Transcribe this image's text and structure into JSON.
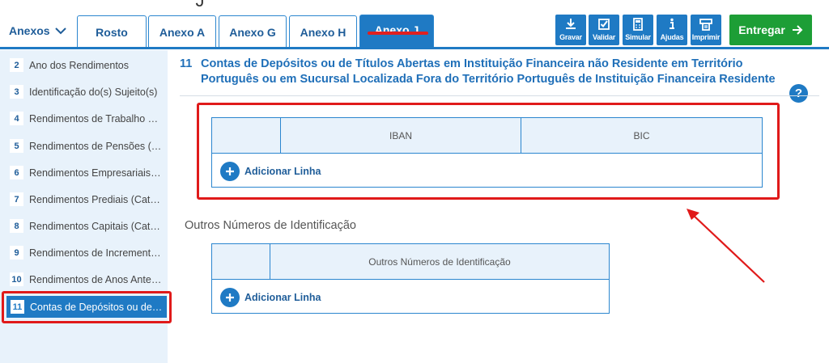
{
  "header": {
    "cut_title": "ˆ J",
    "anexos_label": "Anexos",
    "tabs": [
      {
        "label": "Rosto",
        "active": false
      },
      {
        "label": "Anexo A",
        "active": false
      },
      {
        "label": "Anexo G",
        "active": false
      },
      {
        "label": "Anexo H",
        "active": false
      },
      {
        "label": "Anexo J",
        "active": true
      }
    ],
    "tools": [
      {
        "label": "Gravar",
        "icon": "download-icon"
      },
      {
        "label": "Validar",
        "icon": "checkbox-icon"
      },
      {
        "label": "Simular",
        "icon": "calculator-icon"
      },
      {
        "label": "Ajudas",
        "icon": "info-icon"
      },
      {
        "label": "Imprimir",
        "icon": "printer-icon"
      }
    ],
    "submit_label": "Entregar"
  },
  "sidebar": {
    "items": [
      {
        "num": "2",
        "label": "Ano dos Rendimentos"
      },
      {
        "num": "3",
        "label": "Identificação do(s) Sujeito(s)"
      },
      {
        "num": "4",
        "label": "Rendimentos de Trabalho Dependente"
      },
      {
        "num": "5",
        "label": "Rendimentos de Pensões (Categoria H)"
      },
      {
        "num": "6",
        "label": "Rendimentos Empresariais e Profissionais"
      },
      {
        "num": "7",
        "label": "Rendimentos Prediais (Categoria F)"
      },
      {
        "num": "8",
        "label": "Rendimentos Capitais (Categoria E)"
      },
      {
        "num": "9",
        "label": "Rendimentos de Incrementos Patrimoniais"
      },
      {
        "num": "10",
        "label": "Rendimentos de Anos Anteriores"
      },
      {
        "num": "11",
        "label": "Contas de Depósitos ou de Títulos",
        "active": true
      }
    ]
  },
  "main": {
    "section_number": "11",
    "section_title": "Contas de Depósitos ou de Títulos Abertas em Instituição Financeira não Residente em Território Português ou em Sucursal Localizada Fora do Território Português de Instituição Financeira Residente",
    "help_label": "?",
    "table1": {
      "columns": [
        "",
        "IBAN",
        "BIC"
      ],
      "add_label": "Adicionar Linha"
    },
    "subsection_title": "Outros Números de Identificação",
    "table2": {
      "columns": [
        "",
        "Outros Números de Identificação"
      ],
      "add_label": "Adicionar Linha"
    }
  },
  "colors": {
    "primary": "#1f7ac4",
    "submit": "#1d9e36",
    "highlight": "#e01a1a",
    "sidebar_bg": "#e8f2fb"
  }
}
